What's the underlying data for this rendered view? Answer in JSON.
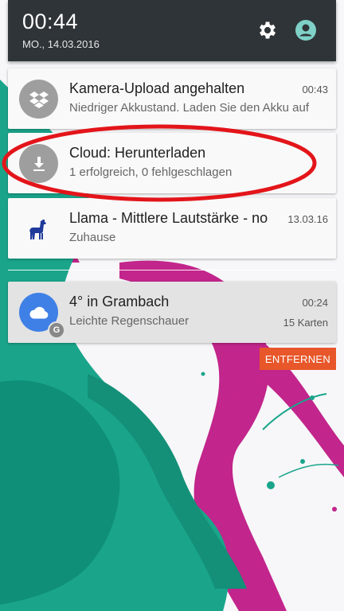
{
  "status": {
    "time": "00:44",
    "date": "MO., 14.03.2016"
  },
  "quick_settings": {
    "settings_icon": "gear-icon",
    "user_icon": "account-icon"
  },
  "notifications": [
    {
      "app": "dropbox",
      "icon": "dropbox-icon",
      "icon_color": "#9e9e9e",
      "title": "Kamera-Upload angehalten",
      "time": "00:43",
      "text": "Niedriger Akkustand. Laden Sie den Akku auf"
    },
    {
      "app": "cloud",
      "icon": "download-icon",
      "icon_color": "#9e9e9e",
      "title": "Cloud: Herunterladen",
      "text": "1 erfolgreich, 0 fehlgeschlagen"
    },
    {
      "app": "llama",
      "icon": "llama-icon",
      "title": "Llama - Mittlere Lautstärke - no",
      "time": "13.03.16",
      "text": "Zuhause"
    },
    {
      "app": "google",
      "icon": "cloud-weather-icon",
      "icon_color": "#3f80e6",
      "badge_icon": "google-badge-icon",
      "badge_letter": "G",
      "title": "4° in Grambach",
      "time": "00:24",
      "text": "Leichte Regenschauer",
      "count": "15 Karten"
    }
  ],
  "actions": {
    "remove_label": "ENTFERNEN"
  },
  "colors": {
    "statusbar": "#2f3438",
    "remove_button": "#e8572a",
    "annotation": "#e3151a"
  }
}
